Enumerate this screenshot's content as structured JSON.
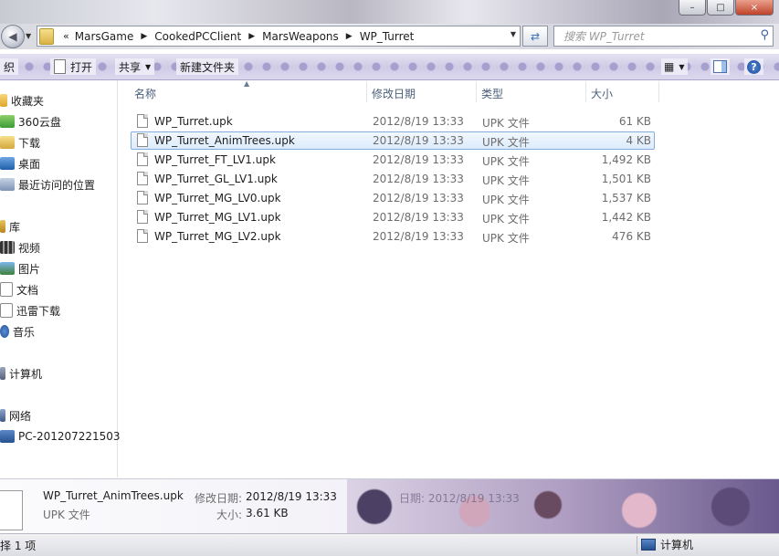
{
  "window": {
    "controls": [
      "–",
      "□",
      "×"
    ]
  },
  "address": {
    "more": "«",
    "crumbs": [
      "MarsGame",
      "CookedPCClient",
      "MarsWeapons",
      "WP_Turret"
    ],
    "search_placeholder": "搜索 WP_Turret"
  },
  "toolbar": {
    "organize": "织",
    "open": "打开",
    "share": "共享",
    "new_folder": "新建文件夹"
  },
  "nav": {
    "favorites": "收藏夹",
    "cloud": "360云盘",
    "downloads": "下载",
    "desktop": "桌面",
    "recent": "最近访问的位置",
    "libraries": "库",
    "videos": "视频",
    "pictures": "图片",
    "documents": "文档",
    "thunder": "迅雷下载",
    "music": "音乐",
    "computer": "计算机",
    "network": "网络",
    "pc": "PC-201207221503"
  },
  "columns": {
    "name": "名称",
    "modified": "修改日期",
    "type": "类型",
    "size": "大小"
  },
  "files": [
    {
      "name": "WP_Turret.upk",
      "date": "2012/8/19 13:33",
      "type": "UPK 文件",
      "size": "61 KB"
    },
    {
      "name": "WP_Turret_AnimTrees.upk",
      "date": "2012/8/19 13:33",
      "type": "UPK 文件",
      "size": "4 KB"
    },
    {
      "name": "WP_Turret_FT_LV1.upk",
      "date": "2012/8/19 13:33",
      "type": "UPK 文件",
      "size": "1,492 KB"
    },
    {
      "name": "WP_Turret_GL_LV1.upk",
      "date": "2012/8/19 13:33",
      "type": "UPK 文件",
      "size": "1,501 KB"
    },
    {
      "name": "WP_Turret_MG_LV0.upk",
      "date": "2012/8/19 13:33",
      "type": "UPK 文件",
      "size": "1,537 KB"
    },
    {
      "name": "WP_Turret_MG_LV1.upk",
      "date": "2012/8/19 13:33",
      "type": "UPK 文件",
      "size": "1,442 KB"
    },
    {
      "name": "WP_Turret_MG_LV2.upk",
      "date": "2012/8/19 13:33",
      "type": "UPK 文件",
      "size": "476 KB"
    }
  ],
  "selected_index": 1,
  "details": {
    "name": "WP_Turret_AnimTrees.upk",
    "type": "UPK 文件",
    "modified_label": "修改日期:",
    "modified_value": "2012/8/19 13:33",
    "size_label": "大小:",
    "size_value": "3.61 KB",
    "ghost_text": "日期: 2012/8/19 13:33"
  },
  "status": {
    "left": "择 1 项",
    "right": "计算机"
  }
}
